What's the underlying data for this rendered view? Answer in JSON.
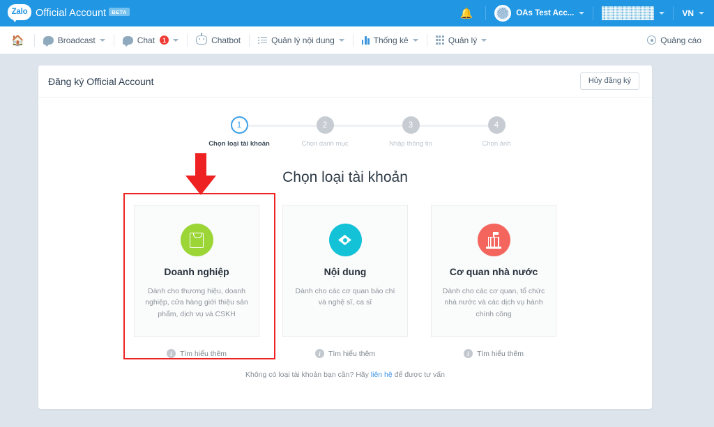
{
  "topbar": {
    "logo_text": "Zalo",
    "brand": "Official Account",
    "beta": "BETA",
    "bell_icon": "bell-icon",
    "account_name": "OAs Test Acc...",
    "blurred_account": "",
    "language": "VN"
  },
  "nav": {
    "home_icon": "home-icon",
    "items": [
      {
        "label": "Broadcast",
        "icon": "chat-bubble-icon",
        "caret": true,
        "badge": null
      },
      {
        "label": "Chat",
        "icon": "chat-bubble-icon",
        "caret": true,
        "badge": "1"
      },
      {
        "label": "Chatbot",
        "icon": "robot-icon",
        "caret": false,
        "badge": null
      },
      {
        "label": "Quản lý nội dung",
        "icon": "list-icon",
        "caret": true,
        "badge": null
      },
      {
        "label": "Thống kê",
        "icon": "bar-chart-icon",
        "caret": true,
        "badge": null
      },
      {
        "label": "Quản lý",
        "icon": "grid-icon",
        "caret": true,
        "badge": null
      }
    ],
    "ads_label": "Quảng cáo",
    "ads_icon": "target-icon"
  },
  "panel": {
    "title": "Đăng ký Official Account",
    "cancel_label": "Hủy đăng ký"
  },
  "stepper": {
    "steps": [
      {
        "number": "1",
        "label": "Chọn loại tài khoản",
        "state": "active"
      },
      {
        "number": "2",
        "label": "Chọn danh mục",
        "state": "inactive"
      },
      {
        "number": "3",
        "label": "Nhập thông tin",
        "state": "inactive"
      },
      {
        "number": "4",
        "label": "Chọn ảnh",
        "state": "inactive"
      }
    ]
  },
  "main": {
    "heading": "Chọn loại tài khoản",
    "cards": [
      {
        "title": "Doanh nghiệp",
        "desc": "Dành cho thương hiệu, doanh nghiệp, cửa hàng giới thiệu sản phẩm, dịch vụ và CSKH",
        "icon": "shopping-bag-icon",
        "icon_color": "#9bd536",
        "learn_more": "Tìm hiểu thêm"
      },
      {
        "title": "Nội dung",
        "desc": "Dành cho các cơ quan báo chí và nghệ sĩ, ca sĩ",
        "icon": "media-eye-icon",
        "icon_color": "#13c2d6",
        "learn_more": "Tìm hiểu thêm"
      },
      {
        "title": "Cơ quan nhà nước",
        "desc": "Dành cho các cơ quan, tổ chức nhà nước và các dịch vụ hành chính công",
        "icon": "government-building-icon",
        "icon_color": "#f4655d",
        "learn_more": "Tìm hiểu thêm"
      }
    ],
    "footer_before": "Không có loại tài khoản bạn cần? Hãy ",
    "footer_link": "liên hệ",
    "footer_after": " để được tư vấn"
  },
  "annotations": {
    "highlight_color": "#ee2222",
    "arrow_color": "#ee2222",
    "highlight_target": "Doanh nghiệp"
  },
  "colors": {
    "brand_blue": "#2196e3",
    "page_bg": "#dde4ec",
    "link_blue": "#3c92e5",
    "step_active": "#3ca0e8"
  }
}
